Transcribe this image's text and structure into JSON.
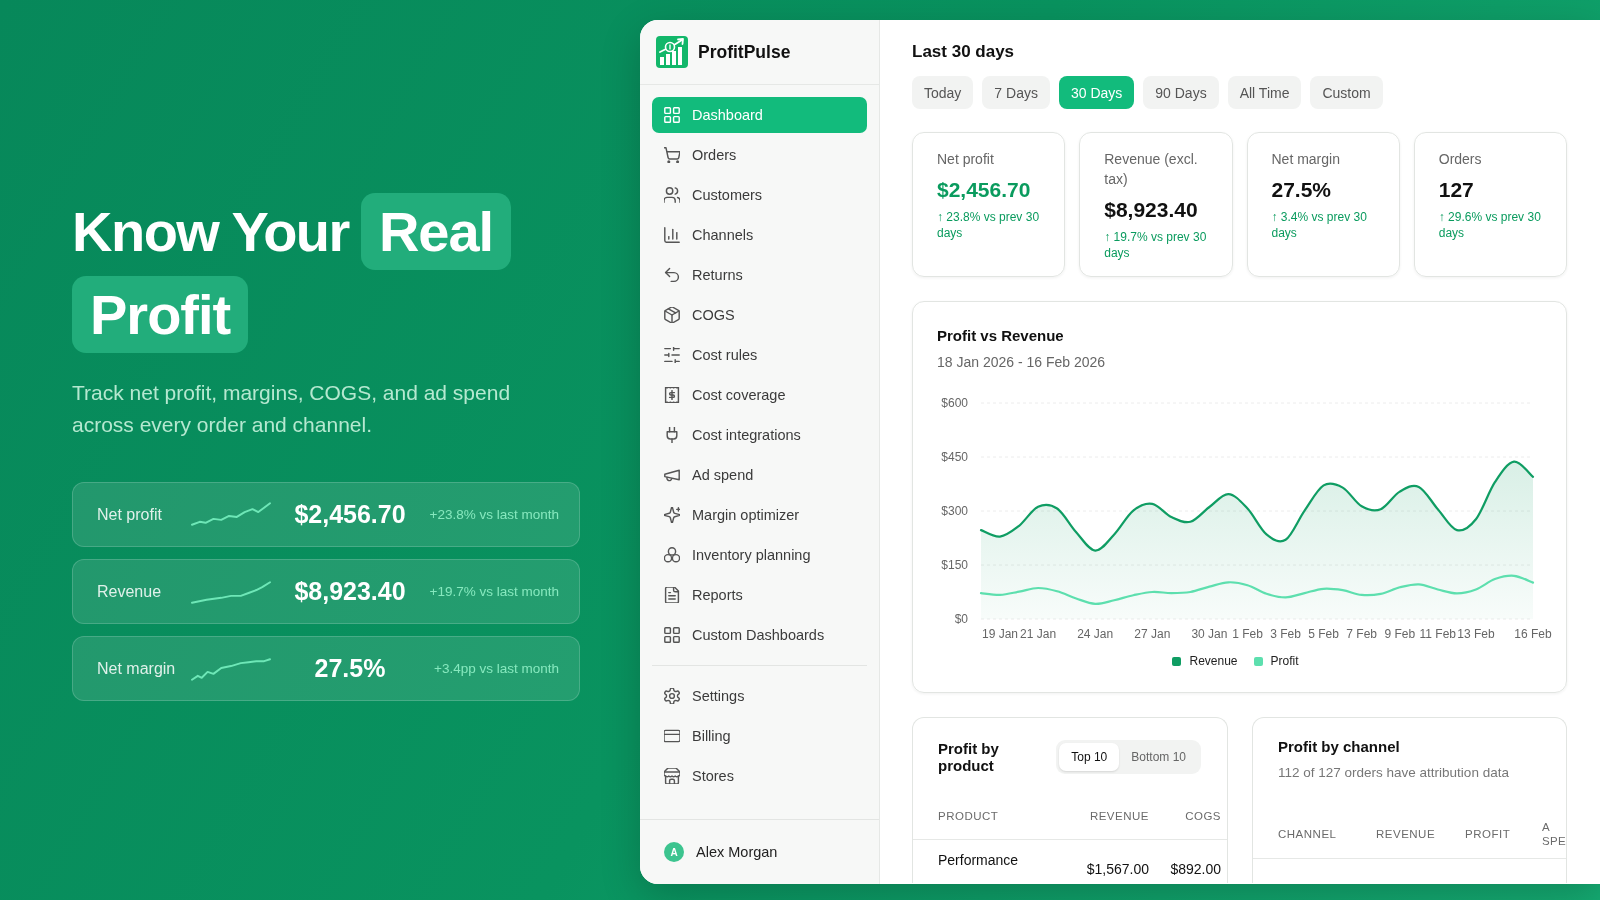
{
  "hero": {
    "headline": [
      {
        "text": "Know Your",
        "highlighted": false
      },
      {
        "text": "Real",
        "highlighted": true
      },
      {
        "text": "Profit",
        "highlighted": true
      }
    ],
    "subtitle": "Track net profit, margins, COGS, and ad spend across every order and channel.",
    "stats": [
      {
        "label": "Net profit",
        "value": "$2,456.70",
        "change": "+23.8% vs last month"
      },
      {
        "label": "Revenue",
        "value": "$8,923.40",
        "change": "+19.7% vs last month"
      },
      {
        "label": "Net margin",
        "value": "27.5%",
        "change": "+3.4pp vs last month"
      }
    ]
  },
  "app": {
    "sidebar": {
      "brand": "ProfitPulse",
      "nav": [
        {
          "label": "Dashboard",
          "selected": true
        },
        {
          "label": "Orders",
          "selected": false
        },
        {
          "label": "Customers",
          "selected": false
        },
        {
          "label": "Channels",
          "selected": false
        },
        {
          "label": "Returns",
          "selected": false
        },
        {
          "label": "COGS",
          "selected": false
        },
        {
          "label": "Cost rules",
          "selected": false
        },
        {
          "label": "Cost coverage",
          "selected": false
        },
        {
          "label": "Cost integrations",
          "selected": false
        },
        {
          "label": "Ad spend",
          "selected": false
        },
        {
          "label": "Margin optimizer",
          "selected": false
        },
        {
          "label": "Inventory planning",
          "selected": false
        },
        {
          "label": "Reports",
          "selected": false
        },
        {
          "label": "Custom Dashboards",
          "selected": false
        }
      ],
      "footer_nav": [
        {
          "label": "Settings",
          "selected": false
        },
        {
          "label": "Billing",
          "selected": false
        },
        {
          "label": "Stores",
          "selected": false
        }
      ],
      "user": {
        "initial": "A",
        "name": "Alex Morgan"
      }
    },
    "main": {
      "title": "Last 30 days",
      "ranges": [
        {
          "label": "Today",
          "selected": false
        },
        {
          "label": "7 Days",
          "selected": false
        },
        {
          "label": "30 Days",
          "selected": true
        },
        {
          "label": "90 Days",
          "selected": false
        },
        {
          "label": "All Time",
          "selected": false
        },
        {
          "label": "Custom",
          "selected": false
        }
      ],
      "kpis": [
        {
          "label": "Net profit",
          "value": "$2,456.70",
          "change": "↑ 23.8% vs prev 30 days",
          "highlighted": true
        },
        {
          "label": "Revenue (excl. tax)",
          "value": "$8,923.40",
          "change": "↑ 19.7% vs prev 30 days",
          "highlighted": false
        },
        {
          "label": "Net margin",
          "value": "27.5%",
          "change": "↑ 3.4% vs prev 30 days",
          "highlighted": false
        },
        {
          "label": "Orders",
          "value": "127",
          "change": "↑ 29.6% vs prev 30 days",
          "highlighted": false
        }
      ],
      "profit_chart": {
        "date_range": "18 Jan 2026 - 16 Feb 2026",
        "chart_data": {
          "type": "area",
          "title": "Profit vs Revenue",
          "categories": [
            null,
            "19 Jan",
            null,
            "21 Jan",
            null,
            null,
            "24 Jan",
            null,
            null,
            "27 Jan",
            null,
            null,
            "30 Jan",
            null,
            "1 Feb",
            null,
            "3 Feb",
            null,
            "5 Feb",
            null,
            "7 Feb",
            null,
            "9 Feb",
            null,
            "11 Feb",
            null,
            "13 Feb",
            null,
            null,
            "16 Feb"
          ],
          "ylim": [
            0,
            600
          ],
          "yticks": [
            {
              "value": 0,
              "label": "$0"
            },
            {
              "value": 150,
              "label": "$150"
            },
            {
              "value": 300,
              "label": "$300"
            },
            {
              "value": 450,
              "label": "$450"
            },
            {
              "value": 600,
              "label": "$600"
            }
          ],
          "grid": true,
          "legend": "bottom",
          "series": [
            {
              "name": "Revenue",
              "color": "#0f9d63",
              "values": [
                247,
                229,
                259,
                312,
                307,
                241,
                190,
                235,
                301,
                320,
                283,
                270,
                311,
                347,
                307,
                235,
                220,
                301,
                371,
                365,
                313,
                305,
                354,
                367,
                305,
                247,
                277,
                380,
                437,
                395
              ]
            },
            {
              "name": "Profit",
              "color": "#5ddfae",
              "type": "line",
              "values": [
                72,
                67,
                76,
                86,
                77,
                57,
                42,
                52,
                66,
                75,
                72,
                75,
                90,
                102,
                94,
                70,
                60,
                72,
                84,
                80,
                67,
                70,
                88,
                96,
                82,
                71,
                82,
                111,
                120,
                101
              ]
            }
          ]
        }
      },
      "product_table": {
        "title": "Profit by product",
        "filters": [
          {
            "label": "Top 10",
            "selected": true
          },
          {
            "label": "Bottom 10",
            "selected": false
          }
        ],
        "columns": [
          "PRODUCT",
          "REVENUE",
          "COGS"
        ],
        "rows": [
          [
            "Performance",
            "$1,567.00",
            "$892.00"
          ]
        ]
      },
      "channel_table": {
        "title": "Profit by channel",
        "subtitle": "112 of 127 orders have attribution data",
        "columns": [
          "CHANNEL",
          "REVENUE",
          "PROFIT",
          "A SPE"
        ]
      }
    }
  }
}
